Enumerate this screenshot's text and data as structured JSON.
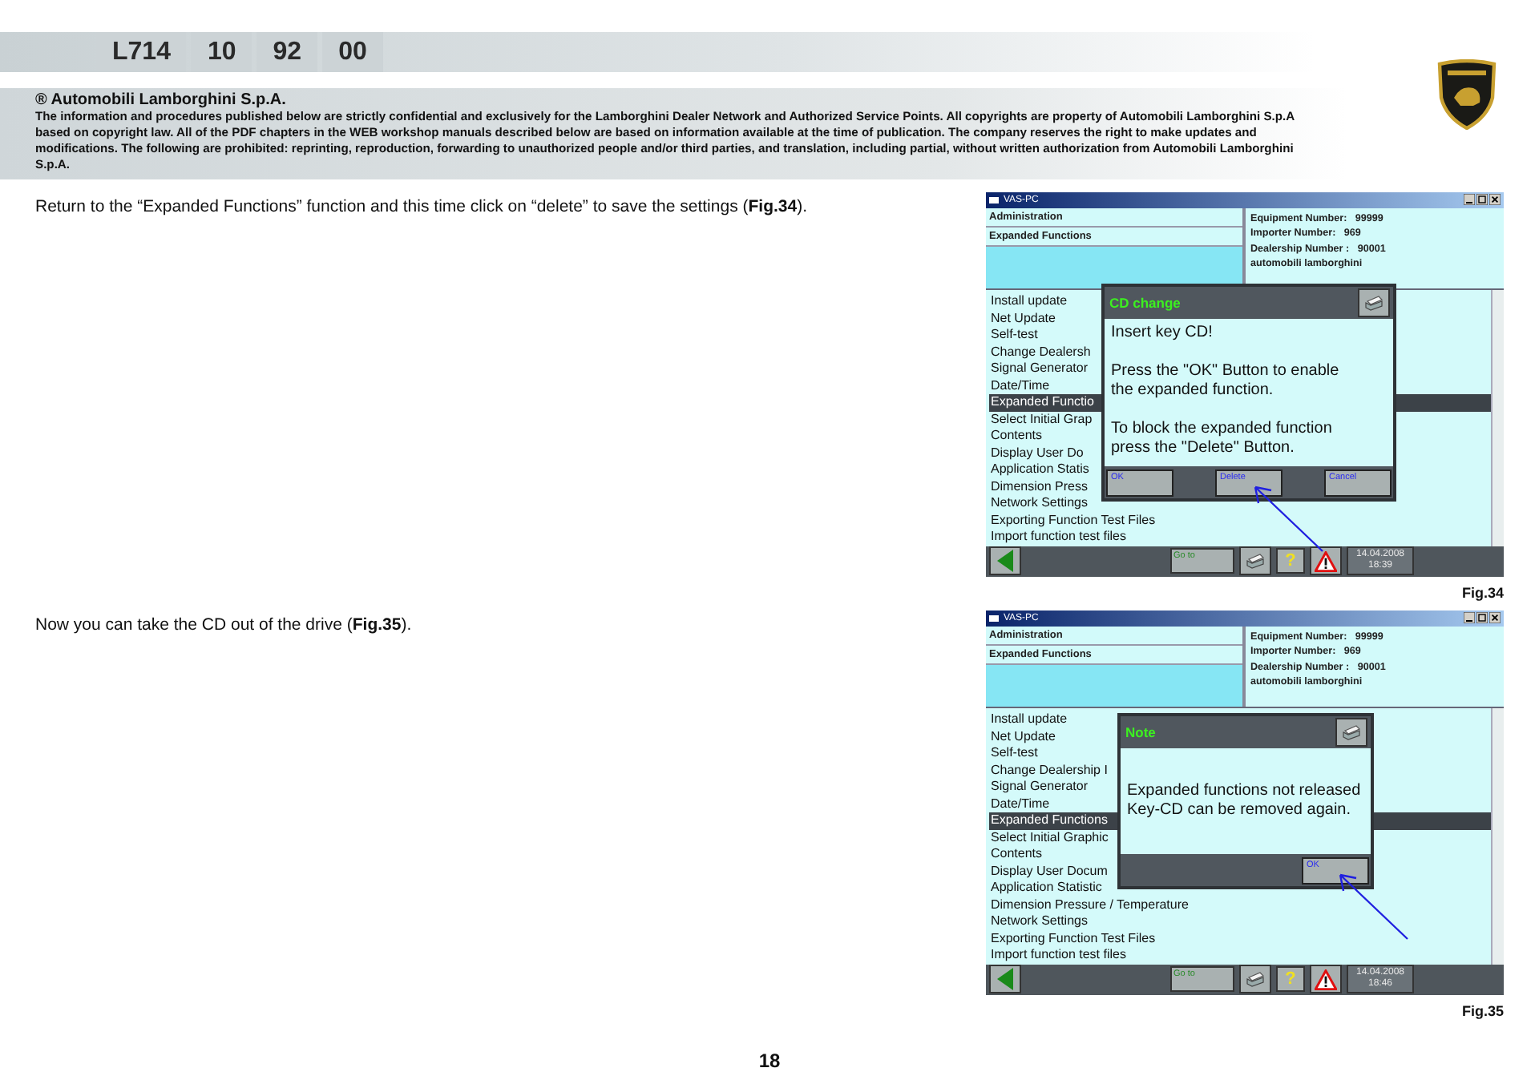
{
  "header": {
    "codes": [
      "L714",
      "10",
      "92",
      "00"
    ]
  },
  "notice": {
    "title": "® Automobili Lamborghini S.p.A.",
    "text": "The information and procedures published below are strictly confidential and exclusively for the Lamborghini Dealer Network and Authorized Service Points. All copyrights are property of Automobili Lamborghini S.p.A based on copyright law. All of the PDF chapters in the WEB workshop manuals described below are based on information available at the time of publication. The company reserves the right to make updates and modifications. The following are prohibited: reprinting, reproduction, forwarding to unauthorized people and/or third parties, and translation, including partial, without written authorization from Automobili Lamborghini S.p.A."
  },
  "steps": [
    {
      "text": "Return to the “Expanded Functions” function and this time click on “delete” to save the settings (**Fig.34**).",
      "figure": {
        "window_title": "VAS-PC",
        "breadcrumb": [
          "Administration",
          "Expanded Functions"
        ],
        "info": [
          "Equipment Number:   99999",
          "Importer Number:   969",
          "Dealership Number :   90001",
          "automobili lamborghini"
        ],
        "menu": [
          {
            "label": "Install update",
            "selected": false
          },
          {
            "label": "Net Update",
            "selected": false
          },
          {
            "label": "Self-test",
            "selected": false
          },
          {
            "label": "Change Dealersh",
            "selected": false
          },
          {
            "label": "Signal Generator",
            "selected": false
          },
          {
            "label": "Date/Time",
            "selected": false
          },
          {
            "label": "Expanded Functio",
            "selected": true
          },
          {
            "label": "Select Initial Grap",
            "selected": false
          },
          {
            "label": "Contents",
            "selected": false
          },
          {
            "label": "Display User Do",
            "selected": false
          },
          {
            "label": "Application Statis",
            "selected": false
          },
          {
            "label": "Dimension Press",
            "selected": false
          },
          {
            "label": "Network Settings",
            "selected": false
          },
          {
            "label": "Exporting Function Test Files",
            "selected": false
          },
          {
            "label": "Import function test files",
            "selected": false
          }
        ],
        "dialog": {
          "kind": "confirm",
          "title": "CD change",
          "message": [
            [
              "Insert key CD!"
            ],
            [
              "Press the \"OK\" Button to enable",
              "the expanded function."
            ],
            [
              "To block the expanded function",
              "press the \"Delete\" Button."
            ]
          ],
          "buttons": [
            {
              "label": "OK",
              "pointed": false
            },
            {
              "label": "Delete",
              "pointed": true
            },
            {
              "label": "Cancel",
              "pointed": false
            }
          ]
        },
        "footer": {
          "goto": "Go to",
          "help": "?",
          "date": "14.04.2008",
          "time": "18:39"
        },
        "caption": "Fig.34"
      }
    },
    {
      "text": "Now you can take the CD out of the drive (**Fig.35**).",
      "figure": {
        "window_title": "VAS-PC",
        "breadcrumb": [
          "Administration",
          "Expanded Functions"
        ],
        "info": [
          "Equipment Number:   99999",
          "Importer Number:   969",
          "Dealership Number :   90001",
          "automobili lamborghini"
        ],
        "menu": [
          {
            "label": "Install update",
            "selected": false
          },
          {
            "label": "Net Update",
            "selected": false
          },
          {
            "label": "Self-test",
            "selected": false
          },
          {
            "label": "Change Dealership I",
            "selected": false
          },
          {
            "label": "Signal Generator",
            "selected": false
          },
          {
            "label": "Date/Time",
            "selected": false
          },
          {
            "label": "Expanded Functions",
            "selected": true
          },
          {
            "label": "Select Initial Graphic",
            "selected": false
          },
          {
            "label": "Contents",
            "selected": false
          },
          {
            "label": "Display User Docum",
            "selected": false
          },
          {
            "label": "Application Statistic",
            "selected": false
          },
          {
            "label": "Dimension Pressure / Temperature",
            "selected": false
          },
          {
            "label": "Network Settings",
            "selected": false
          },
          {
            "label": "Exporting Function Test Files",
            "selected": false
          },
          {
            "label": "Import function test files",
            "selected": false
          }
        ],
        "dialog": {
          "kind": "note",
          "title": "Note",
          "message": [
            [
              "Expanded functions not released",
              "Key-CD can be removed again."
            ]
          ],
          "buttons": [
            {
              "label": "OK",
              "pointed": true
            }
          ]
        },
        "footer": {
          "goto": "Go to",
          "help": "?",
          "date": "14.04.2008",
          "time": "18:46"
        },
        "caption": "Fig.35"
      }
    }
  ],
  "page_number": "18"
}
